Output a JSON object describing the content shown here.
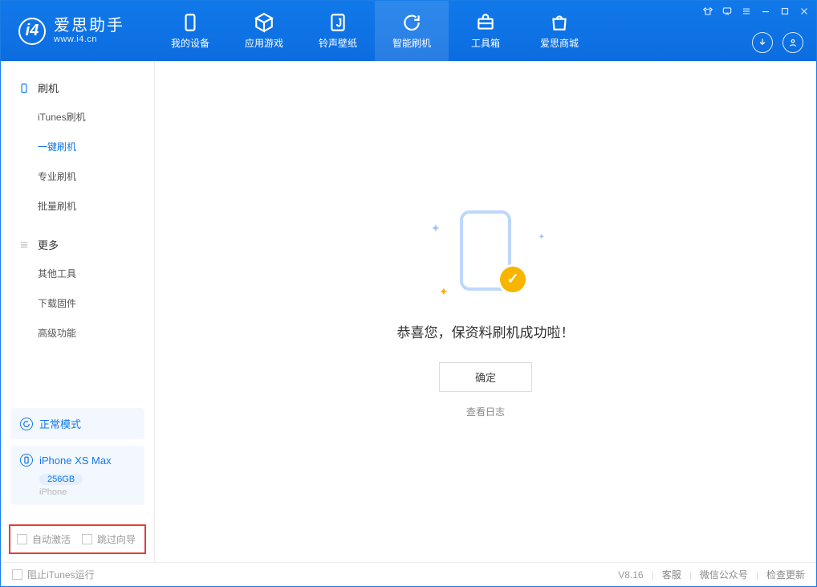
{
  "app": {
    "title": "爱思助手",
    "subtitle": "www.i4.cn"
  },
  "nav": {
    "items": [
      {
        "label": "我的设备"
      },
      {
        "label": "应用游戏"
      },
      {
        "label": "铃声壁纸"
      },
      {
        "label": "智能刷机"
      },
      {
        "label": "工具箱"
      },
      {
        "label": "爱思商城"
      }
    ]
  },
  "sidebar": {
    "section_flash": "刷机",
    "flash_items": [
      {
        "label": "iTunes刷机"
      },
      {
        "label": "一键刷机"
      },
      {
        "label": "专业刷机"
      },
      {
        "label": "批量刷机"
      }
    ],
    "section_more": "更多",
    "more_items": [
      {
        "label": "其他工具"
      },
      {
        "label": "下载固件"
      },
      {
        "label": "高级功能"
      }
    ],
    "mode_card": {
      "label": "正常模式"
    },
    "device_card": {
      "name": "iPhone XS Max",
      "storage": "256GB",
      "type": "iPhone"
    },
    "auto_activate": "自动激活",
    "skip_guide": "跳过向导"
  },
  "main": {
    "success_text": "恭喜您，保资料刷机成功啦！",
    "ok": "确定",
    "view_log": "查看日志"
  },
  "statusbar": {
    "block_itunes": "阻止iTunes运行",
    "version": "V8.16",
    "customer_service": "客服",
    "wechat": "微信公众号",
    "check_update": "检查更新"
  }
}
